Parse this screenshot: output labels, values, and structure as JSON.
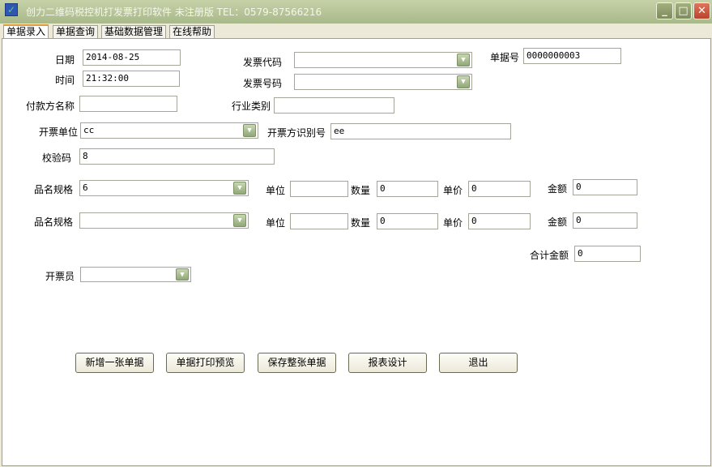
{
  "window": {
    "title": "创力二维码税控机打发票打印软件 未注册版  TEL：0579-87566216",
    "minimize": "_",
    "maximize": "□",
    "close": "✕"
  },
  "tabs": [
    "单据录入",
    "单据查询",
    "基础数据管理",
    "在线帮助"
  ],
  "form": {
    "date_label": "日期",
    "date": "2014-08-25",
    "time_label": "时间",
    "time": "21:32:00",
    "invoice_code_label": "发票代码",
    "invoice_code": "",
    "invoice_number_label": "发票号码",
    "invoice_number": "",
    "doc_no_label": "单据号",
    "doc_no": "0000000003",
    "payer_label": "付款方名称",
    "payer": "",
    "industry_label": "行业类别",
    "industry": "",
    "issuer_label": "开票单位",
    "issuer": "cc",
    "issuer_id_label": "开票方识别号",
    "issuer_id": "ee",
    "check_code_label": "校验码",
    "check_code": "8",
    "items": [
      {
        "name_label": "品名规格",
        "name": "6",
        "unit_label": "单位",
        "unit": "",
        "qty_label": "数量",
        "qty": "0",
        "price_label": "单价",
        "price": "0",
        "amount_label": "金额",
        "amount": "0"
      },
      {
        "name_label": "品名规格",
        "name": "",
        "unit_label": "单位",
        "unit": "",
        "qty_label": "数量",
        "qty": "0",
        "price_label": "单价",
        "price": "0",
        "amount_label": "金额",
        "amount": "0"
      }
    ],
    "total_label": "合计金额",
    "total": "0",
    "clerk_label": "开票员",
    "clerk": ""
  },
  "buttons": [
    "新增一张单据",
    "单据打印预览",
    "保存整张单据",
    "报表设计",
    "退出"
  ]
}
